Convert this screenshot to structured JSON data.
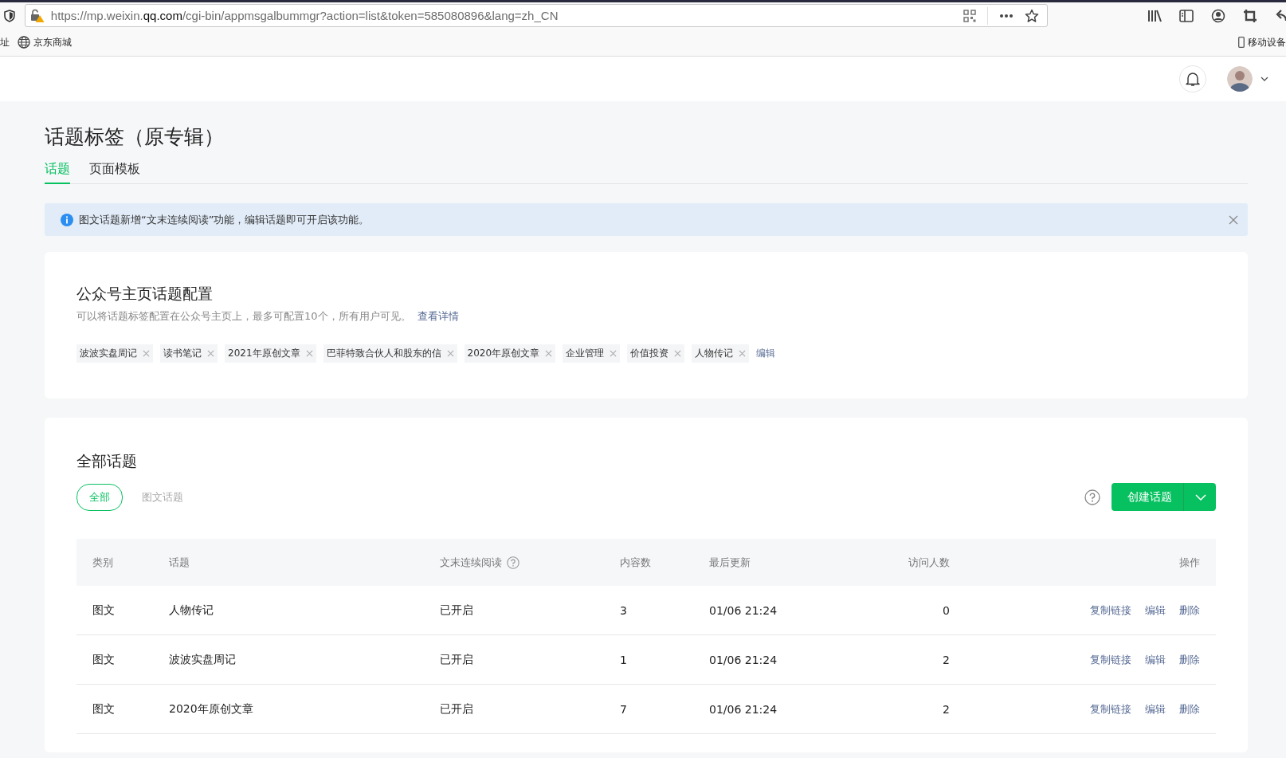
{
  "browser": {
    "url": "https://mp.weixin.**qq.com**/cgi-bin/appmsgalbummgr?action=list&token=585080896&lang=zh_CN",
    "bookmarks": [
      {
        "label": "址",
        "kind": "text"
      },
      {
        "label": "京东商城",
        "kind": "globe"
      }
    ],
    "mobile_bookmark": "移动设备"
  },
  "page": {
    "title": "话题标签（原专辑）",
    "tabs": [
      {
        "label": "话题",
        "selected": true
      },
      {
        "label": "页面模板",
        "selected": false
      }
    ],
    "notice": {
      "text": "图文话题新增“文末连续阅读”功能，编辑话题即可开启该功能。"
    }
  },
  "home_config": {
    "title": "公众号主页话题配置",
    "description": "可以将话题标签配置在公众号主页上，最多可配置10个，所有用户可见。",
    "details_link": "查看详情",
    "tags": [
      "波波实盘周记",
      "读书笔记",
      "2021年原创文章",
      "巴菲特致合伙人和股东的信",
      "2020年原创文章",
      "企业管理",
      "价值投资",
      "人物传记"
    ],
    "edit_link": "编辑"
  },
  "topics": {
    "title": "全部话题",
    "filters": [
      {
        "label": "全部",
        "selected": true
      },
      {
        "label": "图文话题",
        "selected": false
      }
    ],
    "create_button": "创建话题",
    "columns": [
      "类别",
      "话题",
      "文末连续阅读",
      "内容数",
      "最后更新",
      "访问人数",
      "操作"
    ],
    "rows": [
      {
        "category": "图文",
        "topic": "人物传记",
        "continuous_reading": "已开启",
        "count": "3",
        "updated": "01/06 21:24",
        "visitors": "0",
        "actions": [
          "复制链接",
          "编辑",
          "删除"
        ]
      },
      {
        "category": "图文",
        "topic": "波波实盘周记",
        "continuous_reading": "已开启",
        "count": "1",
        "updated": "01/06 21:24",
        "visitors": "2",
        "actions": [
          "复制链接",
          "编辑",
          "删除"
        ]
      },
      {
        "category": "图文",
        "topic": "2020年原创文章",
        "continuous_reading": "已开启",
        "count": "7",
        "updated": "01/06 21:24",
        "visitors": "2",
        "actions": [
          "复制链接",
          "编辑",
          "删除"
        ]
      }
    ]
  }
}
